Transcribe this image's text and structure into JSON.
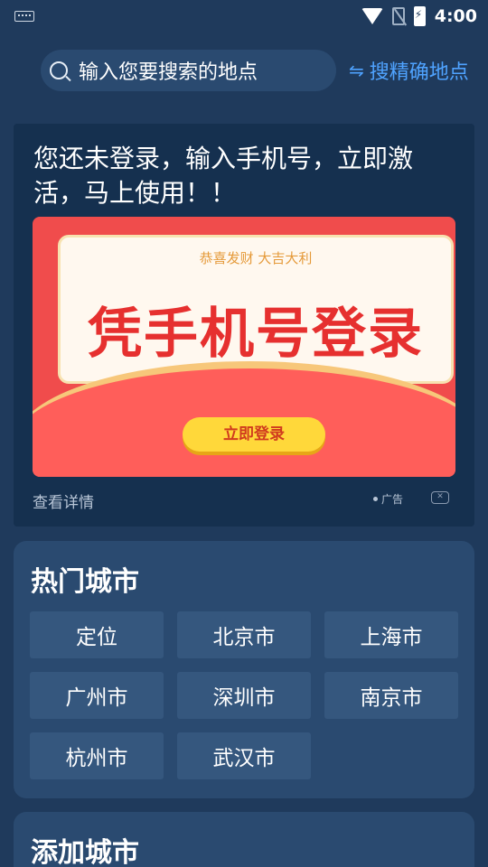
{
  "status_bar": {
    "time": "4:00"
  },
  "search": {
    "placeholder": "输入您要搜索的地点",
    "precise_label": "搜精确地点",
    "swap_glyph": "⇋"
  },
  "ad": {
    "prompt": "您还未登录，输入手机号，立即激活，马上使用！！",
    "banner_subtitle": "恭喜发财 大吉大利",
    "banner_title": "凭手机号登录",
    "banner_button": "立即登录",
    "detail_link": "查看详情",
    "ad_tag": "广告",
    "close_glyph": "✕"
  },
  "hot_cities": {
    "title": "热门城市",
    "items": [
      "定位",
      "北京市",
      "上海市",
      "广州市",
      "深圳市",
      "南京市",
      "杭州市",
      "武汉市"
    ]
  },
  "add_city": {
    "title": "添加城市"
  },
  "colors": {
    "background": "#1f3a5c",
    "card": "#2a4a70",
    "accent": "#4fa3ff",
    "banner_red": "#f04c4c"
  }
}
